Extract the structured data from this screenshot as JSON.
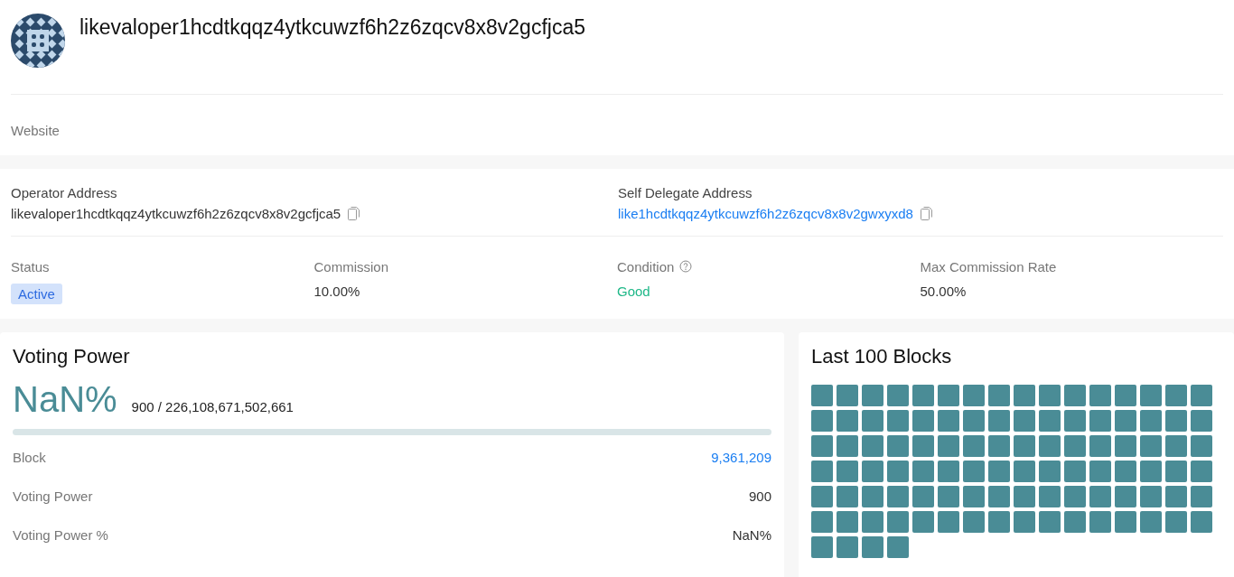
{
  "header": {
    "title": "likevaloper1hcdtkqqz4ytkcuwzf6h2z6zqcv8x8v2gcfjca5",
    "website_label": "Website"
  },
  "addresses": [
    {
      "label": "Operator Address",
      "value": "likevaloper1hcdtkqqz4ytkcuwzf6h2z6zqcv8x8v2gcfjca5",
      "kind": "text"
    },
    {
      "label": "Self Delegate Address",
      "value": "like1hcdtkqqz4ytkcuwzf6h2z6zqcv8x8v2gwxyxd8",
      "kind": "link"
    }
  ],
  "stats": [
    {
      "label": "Status",
      "value": "Active",
      "kind": "badge"
    },
    {
      "label": "Commission",
      "value": "10.00%",
      "kind": "plain"
    },
    {
      "label": "Condition",
      "value": "Good",
      "kind": "good",
      "help": true
    },
    {
      "label": "Max Commission Rate",
      "value": "50.00%",
      "kind": "plain"
    }
  ],
  "voting_power": {
    "title": "Voting Power",
    "percent": "NaN%",
    "ratio": "900 / 226,108,671,502,661",
    "level": 0,
    "rows": [
      {
        "label": "Block",
        "value": "9,361,209",
        "kind": "link"
      },
      {
        "label": "Voting Power",
        "value": "900",
        "kind": "plain"
      },
      {
        "label": "Voting Power %",
        "value": "NaN%",
        "kind": "plain"
      }
    ]
  },
  "blocks": {
    "title": "Last 100 Blocks",
    "items": [
      {
        "signed": true
      },
      {
        "signed": true
      },
      {
        "signed": true
      },
      {
        "signed": true
      },
      {
        "signed": true
      },
      {
        "signed": true
      },
      {
        "signed": true
      },
      {
        "signed": true
      },
      {
        "signed": true
      },
      {
        "signed": true
      },
      {
        "signed": true
      },
      {
        "signed": true
      },
      {
        "signed": true
      },
      {
        "signed": true
      },
      {
        "signed": true
      },
      {
        "signed": true
      },
      {
        "signed": true
      },
      {
        "signed": true
      },
      {
        "signed": true
      },
      {
        "signed": true
      },
      {
        "signed": true
      },
      {
        "signed": true
      },
      {
        "signed": true
      },
      {
        "signed": true
      },
      {
        "signed": true
      },
      {
        "signed": true
      },
      {
        "signed": true
      },
      {
        "signed": true
      },
      {
        "signed": true
      },
      {
        "signed": true
      },
      {
        "signed": true
      },
      {
        "signed": true
      },
      {
        "signed": true
      },
      {
        "signed": true
      },
      {
        "signed": true
      },
      {
        "signed": true
      },
      {
        "signed": true
      },
      {
        "signed": true
      },
      {
        "signed": true
      },
      {
        "signed": true
      },
      {
        "signed": true
      },
      {
        "signed": true
      },
      {
        "signed": true
      },
      {
        "signed": true
      },
      {
        "signed": true
      },
      {
        "signed": true
      },
      {
        "signed": true
      },
      {
        "signed": true
      },
      {
        "signed": true
      },
      {
        "signed": true
      },
      {
        "signed": true
      },
      {
        "signed": true
      },
      {
        "signed": true
      },
      {
        "signed": true
      },
      {
        "signed": true
      },
      {
        "signed": true
      },
      {
        "signed": true
      },
      {
        "signed": true
      },
      {
        "signed": true
      },
      {
        "signed": true
      },
      {
        "signed": true
      },
      {
        "signed": true
      },
      {
        "signed": true
      },
      {
        "signed": true
      },
      {
        "signed": true
      },
      {
        "signed": true
      },
      {
        "signed": true
      },
      {
        "signed": true
      },
      {
        "signed": true
      },
      {
        "signed": true
      },
      {
        "signed": true
      },
      {
        "signed": true
      },
      {
        "signed": true
      },
      {
        "signed": true
      },
      {
        "signed": true
      },
      {
        "signed": true
      },
      {
        "signed": true
      },
      {
        "signed": true
      },
      {
        "signed": true
      },
      {
        "signed": true
      },
      {
        "signed": true
      },
      {
        "signed": true
      },
      {
        "signed": true
      },
      {
        "signed": true
      },
      {
        "signed": true
      },
      {
        "signed": true
      },
      {
        "signed": true
      },
      {
        "signed": true
      },
      {
        "signed": true
      },
      {
        "signed": true
      },
      {
        "signed": true
      },
      {
        "signed": true
      },
      {
        "signed": true
      },
      {
        "signed": true
      },
      {
        "signed": true
      },
      {
        "signed": true
      },
      {
        "signed": true
      },
      {
        "signed": true
      },
      {
        "signed": true
      },
      {
        "signed": true
      }
    ]
  }
}
